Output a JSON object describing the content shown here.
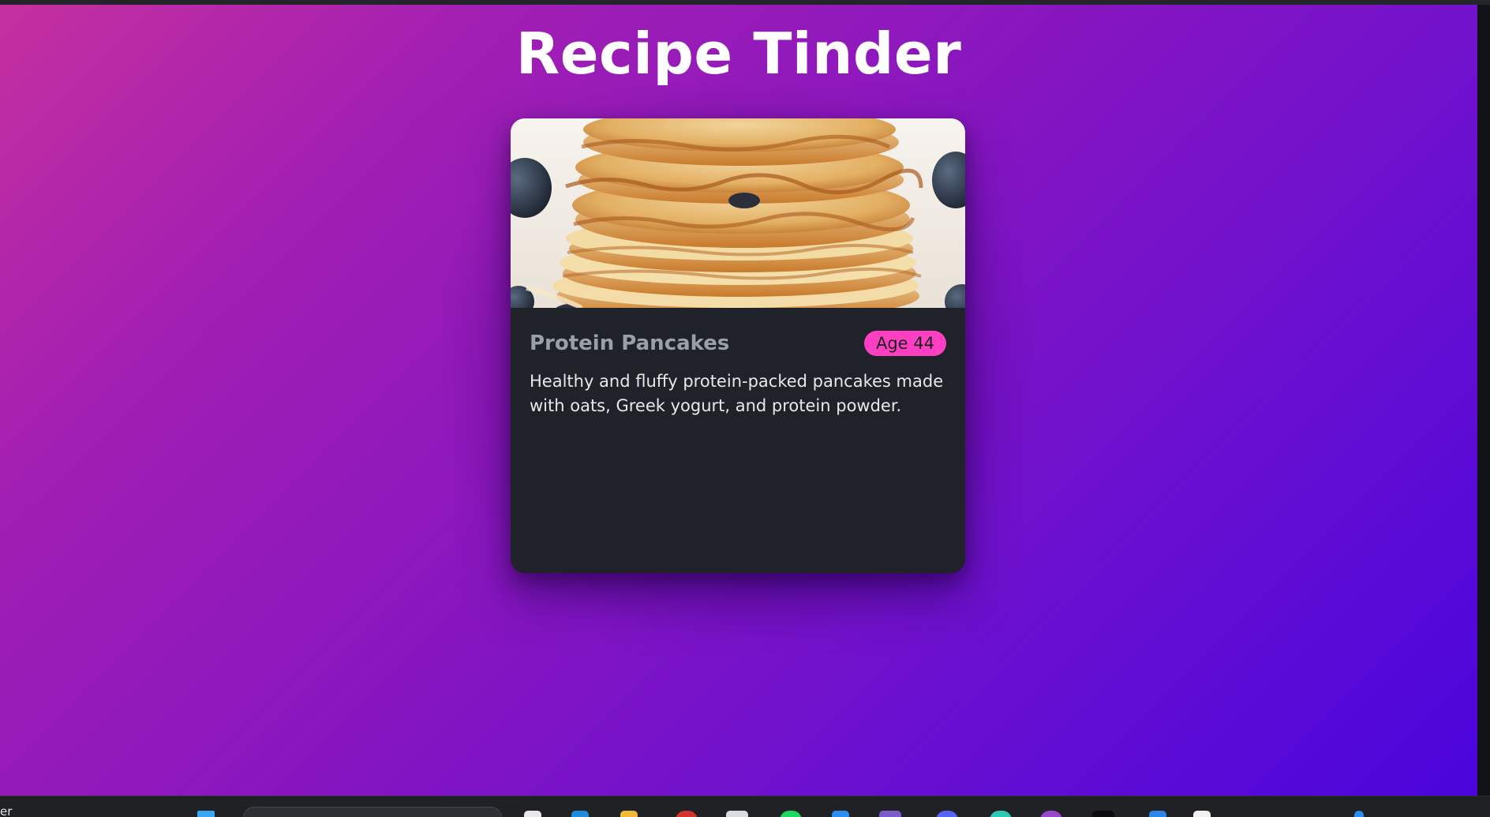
{
  "app": {
    "title": "Recipe Tinder"
  },
  "recipe": {
    "title": "Protein Pancakes",
    "age_badge": "Age 44",
    "description": "Healthy and fluffy protein-packed pancakes made with oats, Greek yogurt, and protein powder.",
    "image_subject": "stack of pancakes with blueberries"
  },
  "actions": {
    "dislike_icon": "close-x-icon",
    "like_icon": "heart-outline-icon"
  },
  "taskbar": {
    "edge_text": "er",
    "icons": [
      "windows-start-icon",
      "search-box",
      "notepad-icon",
      "edge-icon",
      "file-explorer-icon",
      "record-icon",
      "calculator-icon",
      "spotify-icon",
      "vscode-icon",
      "teams-icon",
      "discord-icon",
      "chatgpt-icon",
      "tor-icon",
      "terminal-icon",
      "azure-icon",
      "calendar-icon"
    ]
  },
  "colors": {
    "gradient_start": "#c5309f",
    "gradient_end": "#4a05dc",
    "card_bg": "#1f2228",
    "badge_bg": "#ff3fc2",
    "dislike_bg": "#a6414f",
    "like_bg": "#0b7a5b"
  }
}
